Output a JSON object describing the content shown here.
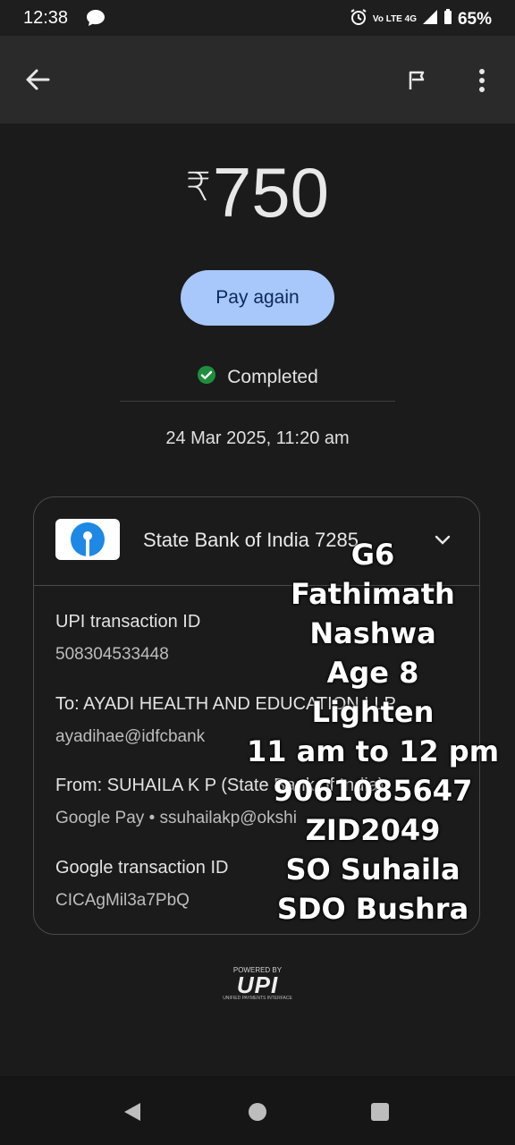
{
  "status_bar": {
    "time": "12:38",
    "network": "Vo LTE 4G",
    "battery": "65%"
  },
  "transaction": {
    "currency_symbol": "₹",
    "amount": "750",
    "pay_again_label": "Pay again",
    "status": "Completed",
    "date": "24 Mar 2025, 11:20 am"
  },
  "card": {
    "bank_name": "State Bank of India 7285",
    "rows": [
      {
        "label": "UPI transaction ID",
        "value": "508304533448"
      },
      {
        "label": "To: AYADI HEALTH AND EDUCATION LLP",
        "value": "ayadihae@idfcbank"
      },
      {
        "label": "From: SUHAILA  K P (State Bank of India)",
        "value": "Google Pay • ssuhailakp@okshi"
      },
      {
        "label": "Google transaction ID",
        "value": "CICAgMil3a7PbQ"
      }
    ]
  },
  "footer": {
    "powered_by": "POWERED BY",
    "upi_brand": "UPI",
    "upi_tag": "UNIFIED PAYMENTS INTERFACE"
  },
  "overlay": {
    "lines": [
      "G6",
      "Fathimath Nashwa",
      "Age 8",
      "Lighten",
      "11 am to 12 pm",
      "9061085647",
      "ZID2049",
      "SO Suhaila",
      "SDO Bushra"
    ]
  },
  "colors": {
    "accent_button": "#a8c7fa",
    "success": "#1e8e3e"
  }
}
